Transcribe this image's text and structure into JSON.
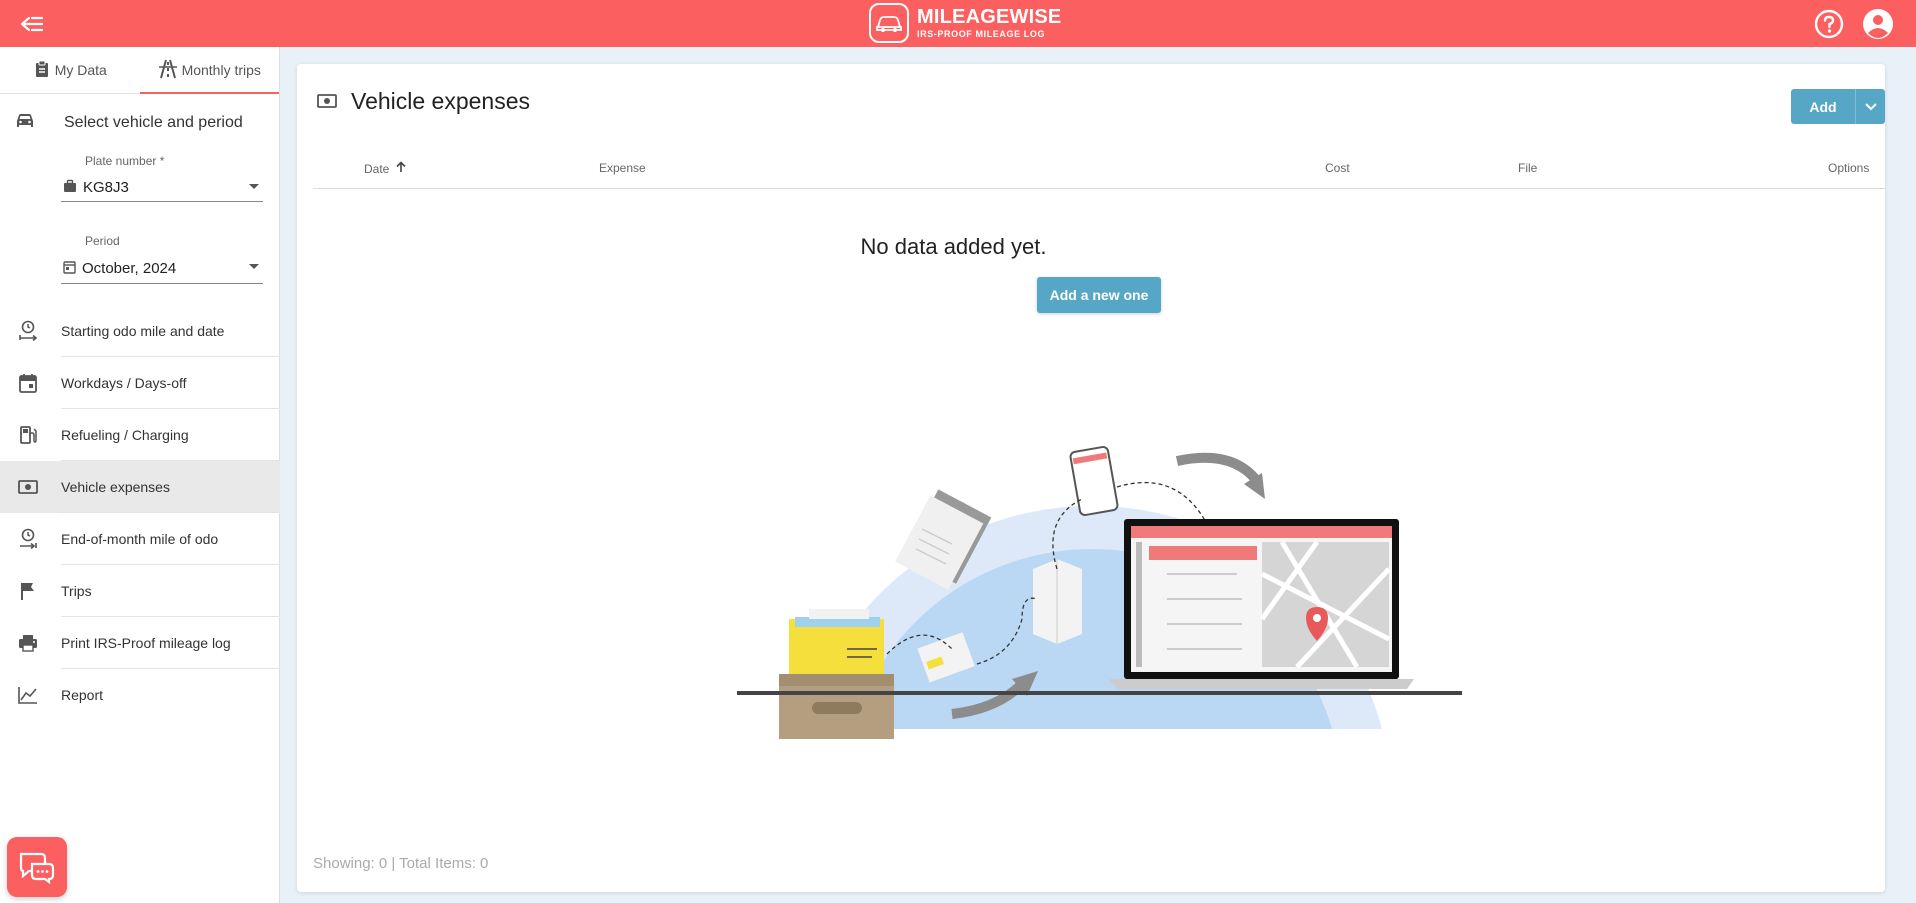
{
  "app": {
    "brand_name": "MILEAGEWISE",
    "brand_tagline": "IRS-PROOF MILEAGE LOG",
    "accent": "#fc5f5f",
    "button_color": "#56a7c6"
  },
  "sidebar": {
    "tabs": [
      {
        "label": "My Data",
        "icon": "clipboard-icon",
        "active": false
      },
      {
        "label": "Monthly trips",
        "icon": "road-icon",
        "active": true
      }
    ],
    "select_heading": "Select vehicle and period",
    "plate": {
      "label": "Plate number *",
      "value": "KG8J3"
    },
    "period": {
      "label": "Period",
      "value": "October, 2024"
    },
    "menu": [
      {
        "label": "Starting odo mile and date",
        "icon": "odometer-start-icon"
      },
      {
        "label": "Workdays / Days-off",
        "icon": "calendar-icon"
      },
      {
        "label": "Refueling / Charging",
        "icon": "fuel-pump-icon"
      },
      {
        "label": "Vehicle expenses",
        "icon": "money-icon",
        "active": true
      },
      {
        "label": "End-of-month mile of odo",
        "icon": "odometer-end-icon"
      },
      {
        "label": "Trips",
        "icon": "flag-icon"
      },
      {
        "label": "Print IRS-Proof mileage log",
        "icon": "printer-icon"
      },
      {
        "label": "Report",
        "icon": "line-chart-icon"
      }
    ]
  },
  "main": {
    "title": "Vehicle expenses",
    "add_label": "Add",
    "columns": [
      {
        "label": "Date",
        "sorted": "asc"
      },
      {
        "label": "Expense"
      },
      {
        "label": "Cost"
      },
      {
        "label": "File"
      },
      {
        "label": "Options"
      }
    ],
    "empty_message": "No data added yet.",
    "add_new_label": "Add a new one",
    "footer_status": "Showing: 0 | Total Items: 0"
  }
}
